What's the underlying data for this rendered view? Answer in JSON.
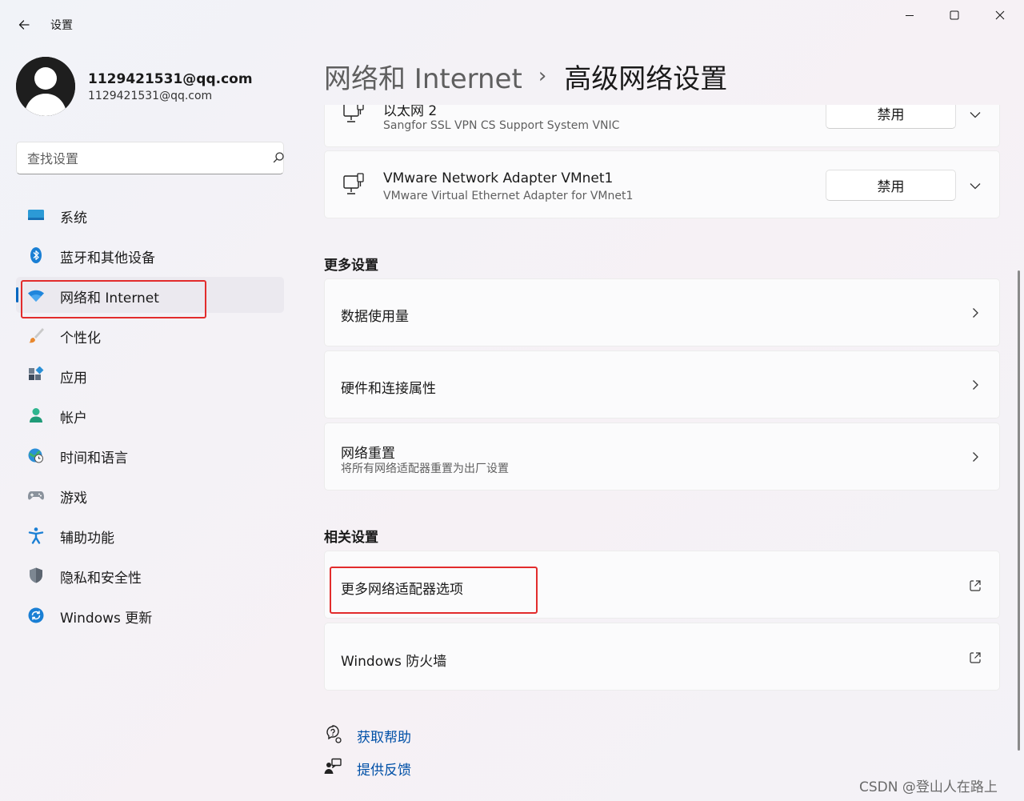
{
  "window": {
    "app_title": "设置",
    "controls": [
      "minimize-icon",
      "maximize-icon",
      "close-icon"
    ]
  },
  "user": {
    "name": "1129421531@qq.com",
    "email": "1129421531@qq.com"
  },
  "search": {
    "placeholder": "查找设置"
  },
  "sidebar": {
    "items": [
      {
        "label": "系统",
        "icon": "display-icon",
        "active": false
      },
      {
        "label": "蓝牙和其他设备",
        "icon": "bluetooth-icon",
        "active": false
      },
      {
        "label": "网络和 Internet",
        "icon": "wifi-icon",
        "active": true
      },
      {
        "label": "个性化",
        "icon": "brush-icon",
        "active": false
      },
      {
        "label": "应用",
        "icon": "apps-icon",
        "active": false
      },
      {
        "label": "帐户",
        "icon": "person-icon",
        "active": false
      },
      {
        "label": "时间和语言",
        "icon": "globe-clock-icon",
        "active": false
      },
      {
        "label": "游戏",
        "icon": "gamepad-icon",
        "active": false
      },
      {
        "label": "辅助功能",
        "icon": "accessibility-icon",
        "active": false
      },
      {
        "label": "隐私和安全性",
        "icon": "shield-icon",
        "active": false
      },
      {
        "label": "Windows 更新",
        "icon": "update-icon",
        "active": false
      }
    ]
  },
  "breadcrumb": {
    "parent": "网络和 Internet",
    "separator": "›",
    "current": "高级网络设置"
  },
  "adapters": [
    {
      "title": "以太网 2",
      "description": "Sangfor SSL VPN CS Support System VNIC",
      "button": "禁用"
    },
    {
      "title": "VMware Network Adapter VMnet1",
      "description": "VMware Virtual Ethernet Adapter for VMnet1",
      "button": "禁用"
    }
  ],
  "more_settings": {
    "title": "更多设置",
    "items": [
      {
        "title": "数据使用量",
        "description": ""
      },
      {
        "title": "硬件和连接属性",
        "description": ""
      },
      {
        "title": "网络重置",
        "description": "将所有网络适配器重置为出厂设置"
      }
    ]
  },
  "related_settings": {
    "title": "相关设置",
    "items": [
      {
        "title": "更多网络适配器选项"
      },
      {
        "title": "Windows 防火墙"
      }
    ]
  },
  "help": {
    "get_help": "获取帮助",
    "feedback": "提供反馈"
  },
  "watermark": "CSDN @登山人在路上",
  "colors": {
    "accent": "#0067c0",
    "link": "#0050a7",
    "highlight_box": "#e22c2c"
  }
}
